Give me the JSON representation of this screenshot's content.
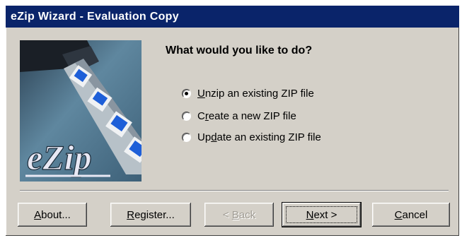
{
  "window": {
    "title": "eZip Wizard - Evaluation Copy"
  },
  "logo": {
    "text": "eZip"
  },
  "main": {
    "question": "What would you like to do?",
    "options": [
      {
        "prefix": "",
        "accel": "U",
        "rest": "nzip an existing ZIP file",
        "selected": true
      },
      {
        "prefix": "C",
        "accel": "r",
        "rest": "eate a new ZIP file",
        "selected": false
      },
      {
        "prefix": "Up",
        "accel": "d",
        "rest": "ate an existing ZIP file",
        "selected": false
      }
    ]
  },
  "buttons": {
    "about": {
      "accel": "A",
      "rest": "bout..."
    },
    "register": {
      "accel": "R",
      "rest": "egister..."
    },
    "back": {
      "prefix": "< ",
      "accel": "B",
      "rest": "ack",
      "disabled": true
    },
    "next": {
      "accel": "N",
      "rest": "ext >",
      "default": true
    },
    "cancel": {
      "accel": "C",
      "rest": "ancel"
    }
  },
  "colors": {
    "titlebar": "#0a246a",
    "dialog": "#d4d0c8",
    "logo_text": "#e8e8f4",
    "disk": "#1e5fd8"
  }
}
